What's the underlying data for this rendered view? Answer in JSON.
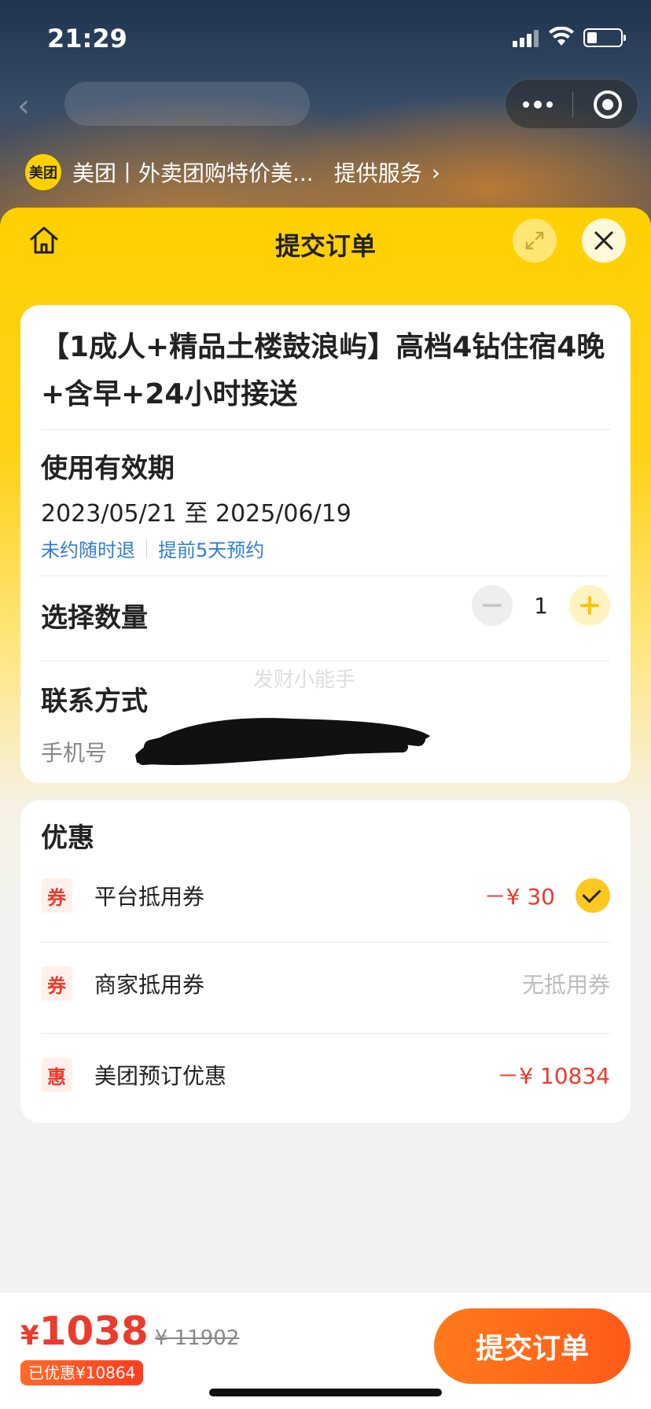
{
  "status": {
    "time": "21:29"
  },
  "provider": {
    "logo_text": "美团",
    "name": "美团丨外卖团购特价美...",
    "suffix": "提供服务"
  },
  "sheet": {
    "title": "提交订单"
  },
  "product": {
    "title": "【1成人+精品土楼鼓浪屿】高档4钻住宿4晚+含早+24小时接送"
  },
  "validity": {
    "label": "使用有效期",
    "dates": "2023/05/21 至 2025/06/19",
    "policies": [
      "未约随时退",
      "提前5天预约"
    ]
  },
  "quantity": {
    "label": "选择数量",
    "value": "1"
  },
  "contact": {
    "label": "联系方式",
    "phone_label": "手机号",
    "watermark": "发财小能手"
  },
  "discounts": {
    "title": "优惠",
    "items": [
      {
        "badge": "券",
        "name": "平台抵用券",
        "amount": "－¥ 30",
        "checked": true
      },
      {
        "badge": "券",
        "name": "商家抵用券",
        "amount": "无抵用券",
        "checked": false
      },
      {
        "badge": "惠",
        "name": "美团预订优惠",
        "amount": "－¥ 10834",
        "checked": false
      }
    ]
  },
  "footer": {
    "currency": "¥",
    "price": "1038",
    "original_price": "¥ 11902",
    "saved": "已优惠¥10864",
    "submit_label": "提交订单"
  },
  "colors": {
    "brand_yellow": "#ffd000",
    "price_red": "#ec3a2c",
    "link_blue": "#2e7fd6",
    "submit_orange": "#ff6a1a"
  }
}
